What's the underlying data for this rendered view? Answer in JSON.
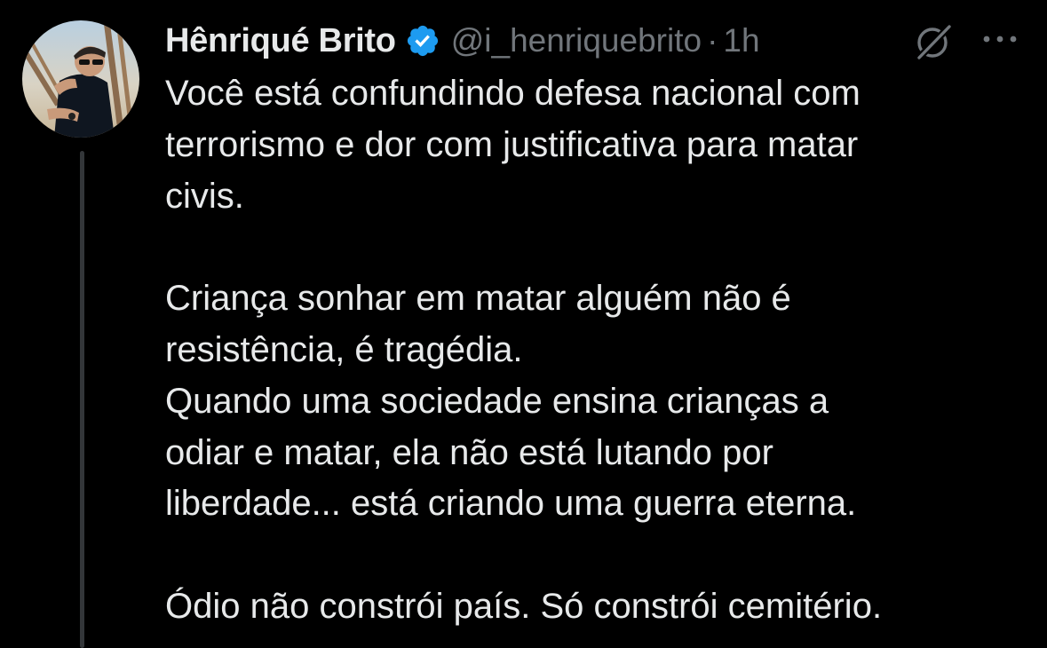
{
  "tweet": {
    "author": {
      "display_name": "Hênriqué Brito",
      "handle": "@i_henriquebrito",
      "verified_icon": "verified-badge-icon",
      "avatar": "avatar"
    },
    "separator": "·",
    "time": "1h",
    "actions": {
      "grok_icon": "grok-icon",
      "more_icon": "more-icon"
    },
    "body": {
      "line_1": "Você está confundindo defesa nacional com",
      "line_2": "terrorismo e dor com justificativa para matar",
      "line_3": "civis.",
      "line_4": "Criança sonhar em matar alguém não é",
      "line_5": "resistência, é tragédia.",
      "line_6": "Quando uma sociedade ensina crianças a",
      "line_7": "odiar e matar, ela não está lutando por",
      "line_8": "liberdade... está criando uma guerra eterna.",
      "line_9": "Ódio não constrói país. Só constrói cemitério."
    }
  },
  "colors": {
    "background": "#000000",
    "text_primary": "#e7e9ea",
    "text_secondary": "#71767b",
    "verified_blue": "#1d9bf0",
    "thread_line": "#333639"
  }
}
